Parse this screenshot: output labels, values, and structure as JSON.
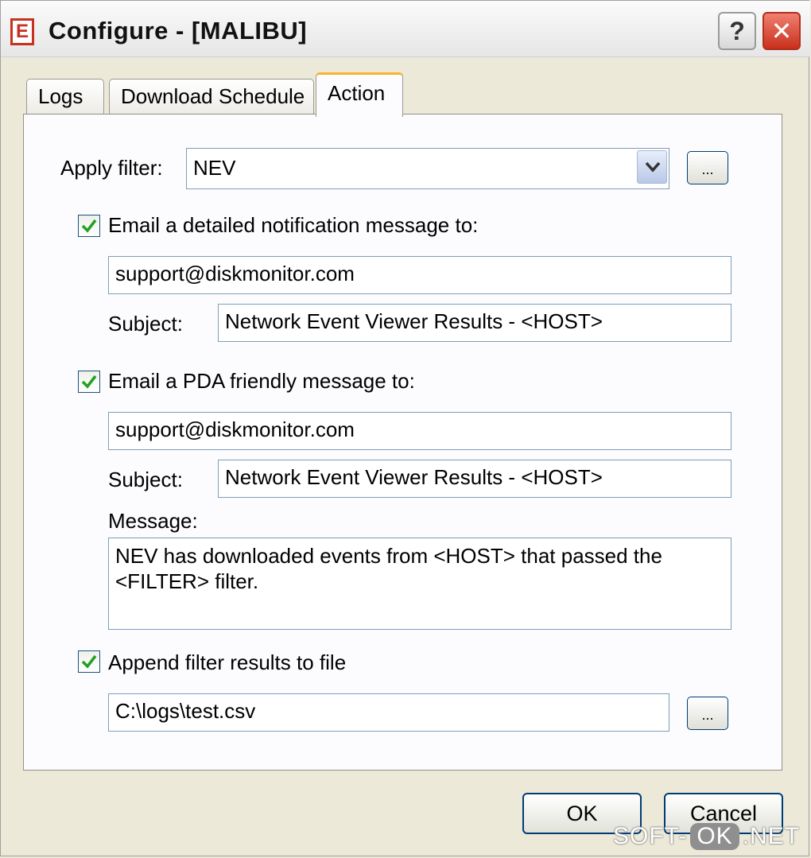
{
  "window": {
    "title": "Configure - [MALIBU]",
    "icon_letter": "E",
    "help_label": "?",
    "close_label": "✕"
  },
  "tabs": [
    {
      "label": "Logs",
      "active": false
    },
    {
      "label": "Download Schedule",
      "active": false
    },
    {
      "label": "Action",
      "active": true
    }
  ],
  "filter": {
    "label": "Apply filter:",
    "value": "NEV",
    "browse_label": "..."
  },
  "email_detailed": {
    "checked": true,
    "label": "Email a detailed notification message to:",
    "address": "support@diskmonitor.com",
    "subject_label": "Subject:",
    "subject": "Network Event Viewer Results - <HOST>"
  },
  "email_pda": {
    "checked": true,
    "label": "Email a PDA friendly message to:",
    "address": "support@diskmonitor.com",
    "subject_label": "Subject:",
    "subject": "Network Event Viewer Results - <HOST>",
    "message_label": "Message:",
    "message": "NEV has downloaded events from <HOST> that passed the <FILTER> filter."
  },
  "append": {
    "checked": true,
    "label": "Append filter results to file",
    "path": "C:\\logs\\test.csv",
    "browse_label": "..."
  },
  "buttons": {
    "ok": "OK",
    "cancel": "Cancel"
  },
  "watermark": {
    "left": "SOFT-",
    "middle": "OK",
    "right": ".NET"
  },
  "colors": {
    "accent_tab": "#f5b330",
    "close_button": "#c8301c",
    "checkmark": "#21a121"
  }
}
